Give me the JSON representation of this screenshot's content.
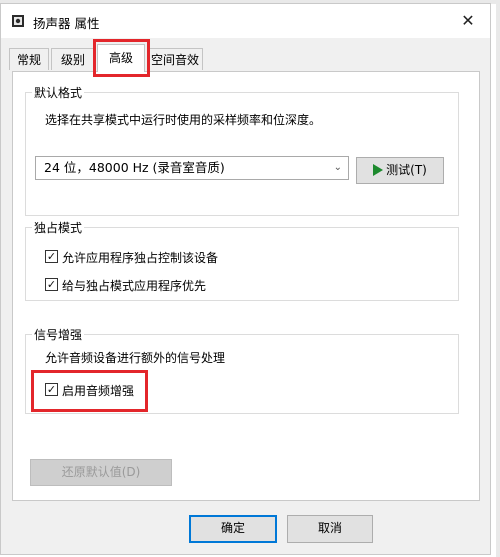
{
  "window": {
    "title": "扬声器 属性",
    "close_glyph": "✕"
  },
  "tabs": [
    {
      "label": "常规"
    },
    {
      "label": "级别"
    },
    {
      "label": "高级",
      "active": true
    },
    {
      "label": "空间音效"
    }
  ],
  "default_format": {
    "group_title": "默认格式",
    "description": "选择在共享模式中运行时使用的采样频率和位深度。",
    "selected_format": "24 位，48000 Hz (录音室音质)",
    "test_button": "测试(T)"
  },
  "exclusive_mode": {
    "group_title": "独占模式",
    "options": [
      {
        "label": "允许应用程序独占控制该设备",
        "checked": true
      },
      {
        "label": "给与独占模式应用程序优先",
        "checked": true
      }
    ]
  },
  "signal_enhancement": {
    "group_title": "信号增强",
    "description": "允许音频设备进行额外的信号处理",
    "option": {
      "label": "启用音频增强",
      "checked": true
    }
  },
  "restore_button": "还原默认值(D)",
  "footer": {
    "ok_label": "确定",
    "cancel_label": "取消"
  },
  "icons": {
    "speaker": "speaker-icon",
    "check": "✓",
    "chevron": "⌄"
  },
  "colors": {
    "highlight": "#e3262b",
    "accent": "#0078d7",
    "play": "#1d8a2e"
  }
}
